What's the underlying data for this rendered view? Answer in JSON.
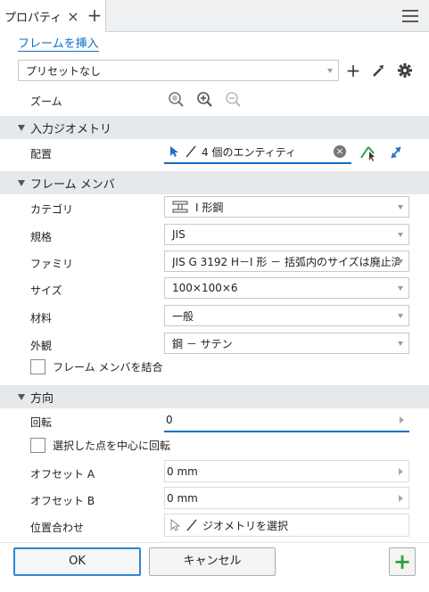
{
  "tab": {
    "title": "プロパティ",
    "close_icon": "×",
    "add_icon": "+"
  },
  "header": {
    "insert_frame_link": "フレームを挿入",
    "preset_value": "プリセットなし"
  },
  "zoom": {
    "label": "ズーム"
  },
  "geometry": {
    "section_title": "入力ジオメトリ",
    "placement_label": "配置",
    "placement_value": "4 個のエンティティ"
  },
  "frame_member": {
    "section_title": "フレーム メンバ",
    "rows": [
      {
        "label": "カテゴリ",
        "value": "I 形鋼"
      },
      {
        "label": "規格",
        "value": "JIS"
      },
      {
        "label": "ファミリ",
        "value": "JIS G 3192 H－I 形 － 括弧内のサイズは廃止済"
      },
      {
        "label": "サイズ",
        "value": "100×100×6"
      },
      {
        "label": "材料",
        "value": "一般"
      },
      {
        "label": "外観",
        "value": "鋼 － サテン"
      }
    ],
    "combine_label": "フレーム メンバを結合"
  },
  "orientation": {
    "section_title": "方向",
    "rotation_label": "回転",
    "rotation_value": "0",
    "rotate_about_point_label": "選択した点を中心に回転",
    "offset_a_label": "オフセット A",
    "offset_a_value": "0 mm",
    "offset_b_label": "オフセット B",
    "offset_b_value": "0 mm",
    "align_label": "位置合わせ",
    "align_placeholder": "ジオメトリを選択"
  },
  "footer": {
    "ok_label": "OK",
    "cancel_label": "キャンセル",
    "add_icon": "+"
  },
  "colors": {
    "accent": "#0f6fc6",
    "section_bg": "#e6e9ec",
    "add_green": "#2f9e44"
  }
}
